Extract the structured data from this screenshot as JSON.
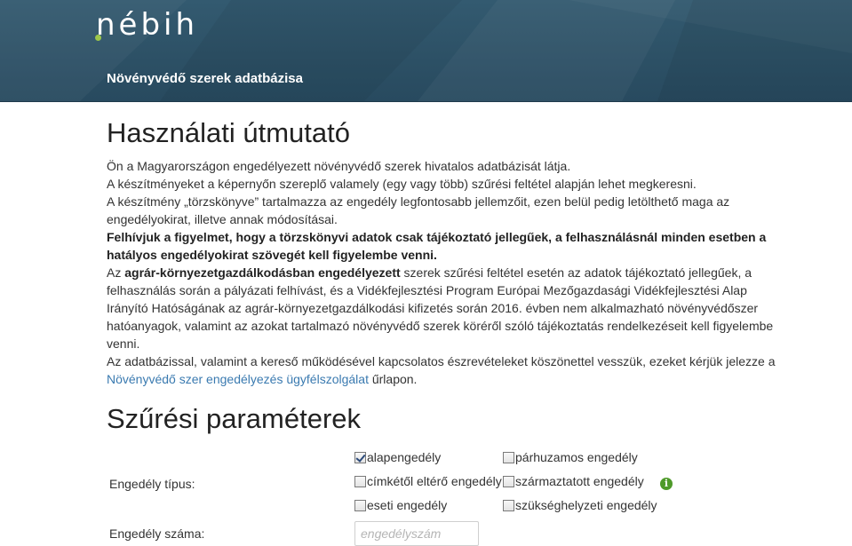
{
  "header": {
    "logo_text": "nébih",
    "site_title": "Növényvédő szerek adatbázisa"
  },
  "guide": {
    "title": "Használati útmutató",
    "p1": "Ön a Magyarországon engedélyezett növényvédő szerek hivatalos adatbázisát látja.",
    "p2": "A készítményeket a képernyőn szereplő valamely (egy vagy több) szűrési feltétel alapján lehet megkeresni.",
    "p3": "A készítmény „törzskönyve” tartalmazza az engedély legfontosabb jellemzőit, ezen belül pedig letölthető maga az engedélyokirat, illetve annak módosításai.",
    "p4_bold": "Felhívjuk a figyelmet, hogy a törzskönyvi adatok csak tájékoztató jellegűek, a felhasználásnál minden esetben a hatályos engedélyokirat szövegét kell figyelembe venni.",
    "p5_start": "Az ",
    "p5_bold": "agrár-környezetgazdálkodásban engedélyezett",
    "p5_rest": " szerek szűrési feltétel esetén az adatok tájékoztató jellegűek, a felhasználás során a pályázati felhívást, és a Vidékfejlesztési Program Európai Mezőgazdasági Vidékfejlesztési Alap Irányító Hatóságának az agrár-környezetgazdálkodási kifizetés során 2016. évben nem alkalmazható növényvédőszer hatóanyagok, valamint az azokat tartalmazó növényvédő szerek köréről szóló tájékoztatás rendelkezéseit kell figyelembe venni.",
    "p6_start": "Az adatbázissal, valamint a kereső működésével kapcsolatos észrevételeket köszönettel vesszük, ezeket kérjük jelezze a ",
    "p6_link": "Növényvédő szer engedélyezés ügyfélszolgálat",
    "p6_end": " űrlapon."
  },
  "filters": {
    "title": "Szűrési paraméterek",
    "type_label": "Engedély típus:",
    "options": [
      {
        "label": "alapengedély",
        "checked": true
      },
      {
        "label": "párhuzamos engedély",
        "checked": false
      },
      {
        "label": "címkétől eltérő engedély",
        "checked": false
      },
      {
        "label": "származtatott engedély",
        "checked": false
      },
      {
        "label": "eseti engedély",
        "checked": false
      },
      {
        "label": "szükséghelyzeti engedély",
        "checked": false
      }
    ],
    "info_icon": "info-icon",
    "number_label": "Engedély száma:",
    "number_value": "",
    "number_placeholder": "engedélyszám"
  },
  "colors": {
    "header_bg": "#2d5166",
    "logo_accent": "#9ec74a",
    "link": "#3a7ab0",
    "info_green": "#4e9a2a"
  }
}
